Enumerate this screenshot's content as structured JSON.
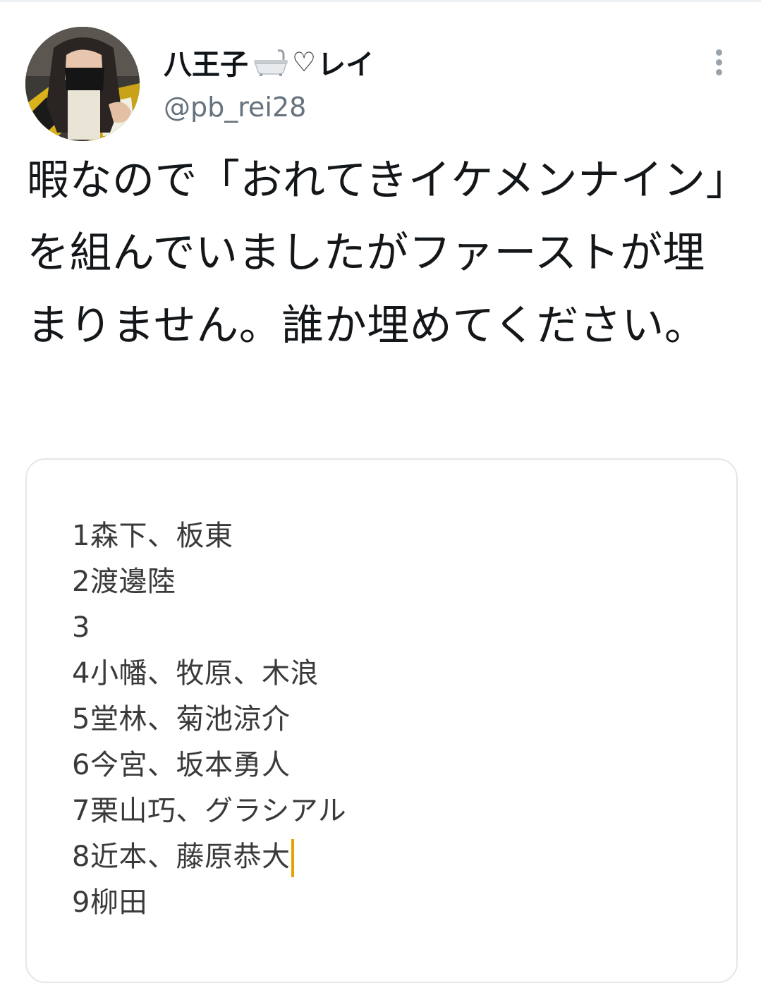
{
  "tweet": {
    "author": {
      "display_name_prefix": "八王子",
      "display_name_icon": "bathtub-icon",
      "display_name_heart": "♡",
      "display_name_suffix": "レイ",
      "handle": "@pb_rei28"
    },
    "text": "暇なので「おれてきイケメンナイン」を組んでいましたがファーストが埋まりません。誰か埋めてください。",
    "more_icon": "more-vertical-icon",
    "media": {
      "lines": [
        "1森下、板東",
        "2渡邊陸",
        "3",
        "4小幡、牧原、木浪",
        "5堂林、菊池涼介",
        "6今宮、坂本勇人",
        "7栗山巧、グラシアル",
        "8近本、藤原恭大",
        "9柳田"
      ],
      "cursor_color": "#e2a400"
    }
  }
}
